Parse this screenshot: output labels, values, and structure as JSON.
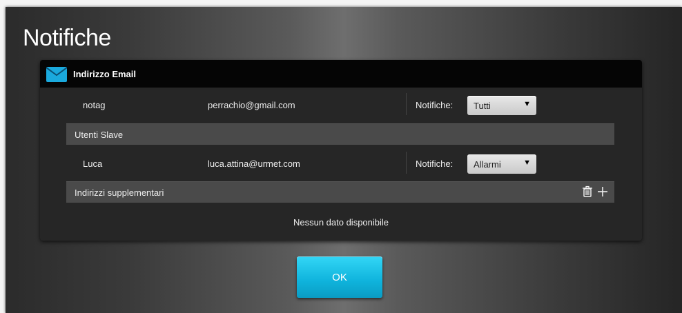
{
  "dialog": {
    "title": "Notifiche",
    "panel": {
      "title": "Indirizzo Email",
      "icon": "mail-icon",
      "main_user": {
        "name": "notag",
        "email": "perrachio@gmail.com",
        "notif_label": "Notifiche:",
        "notif_value": "Tutti"
      },
      "slave_section": {
        "label": "Utenti Slave",
        "users": [
          {
            "name": "Luca",
            "email": "luca.attina@urmet.com",
            "notif_label": "Notifiche:",
            "notif_value": "Allarmi"
          }
        ]
      },
      "extra_section": {
        "label": "Indirizzi supplementari",
        "delete_icon": "trash-icon",
        "add_icon": "plus-icon",
        "empty_text": "Nessun dato disponibile"
      }
    },
    "ok_label": "OK"
  },
  "colors": {
    "accent": "#19bfe6",
    "header_bg": "#050505",
    "section_bg": "#4a4a4a"
  }
}
